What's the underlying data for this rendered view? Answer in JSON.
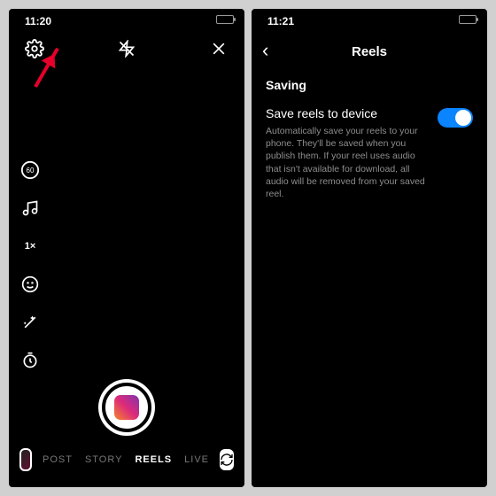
{
  "left": {
    "time": "11:20",
    "modes": {
      "post": "POST",
      "story": "STORY",
      "reels": "REELS",
      "live": "LIVE"
    },
    "speed": "1×",
    "duration_badge": "60"
  },
  "right": {
    "time": "11:21",
    "header": "Reels",
    "section": "Saving",
    "setting_title": "Save reels to device",
    "setting_desc": "Automatically save your reels to your phone. They'll be saved when you publish them. If your reel uses audio that isn't available for download, all audio will be removed from your saved reel."
  }
}
